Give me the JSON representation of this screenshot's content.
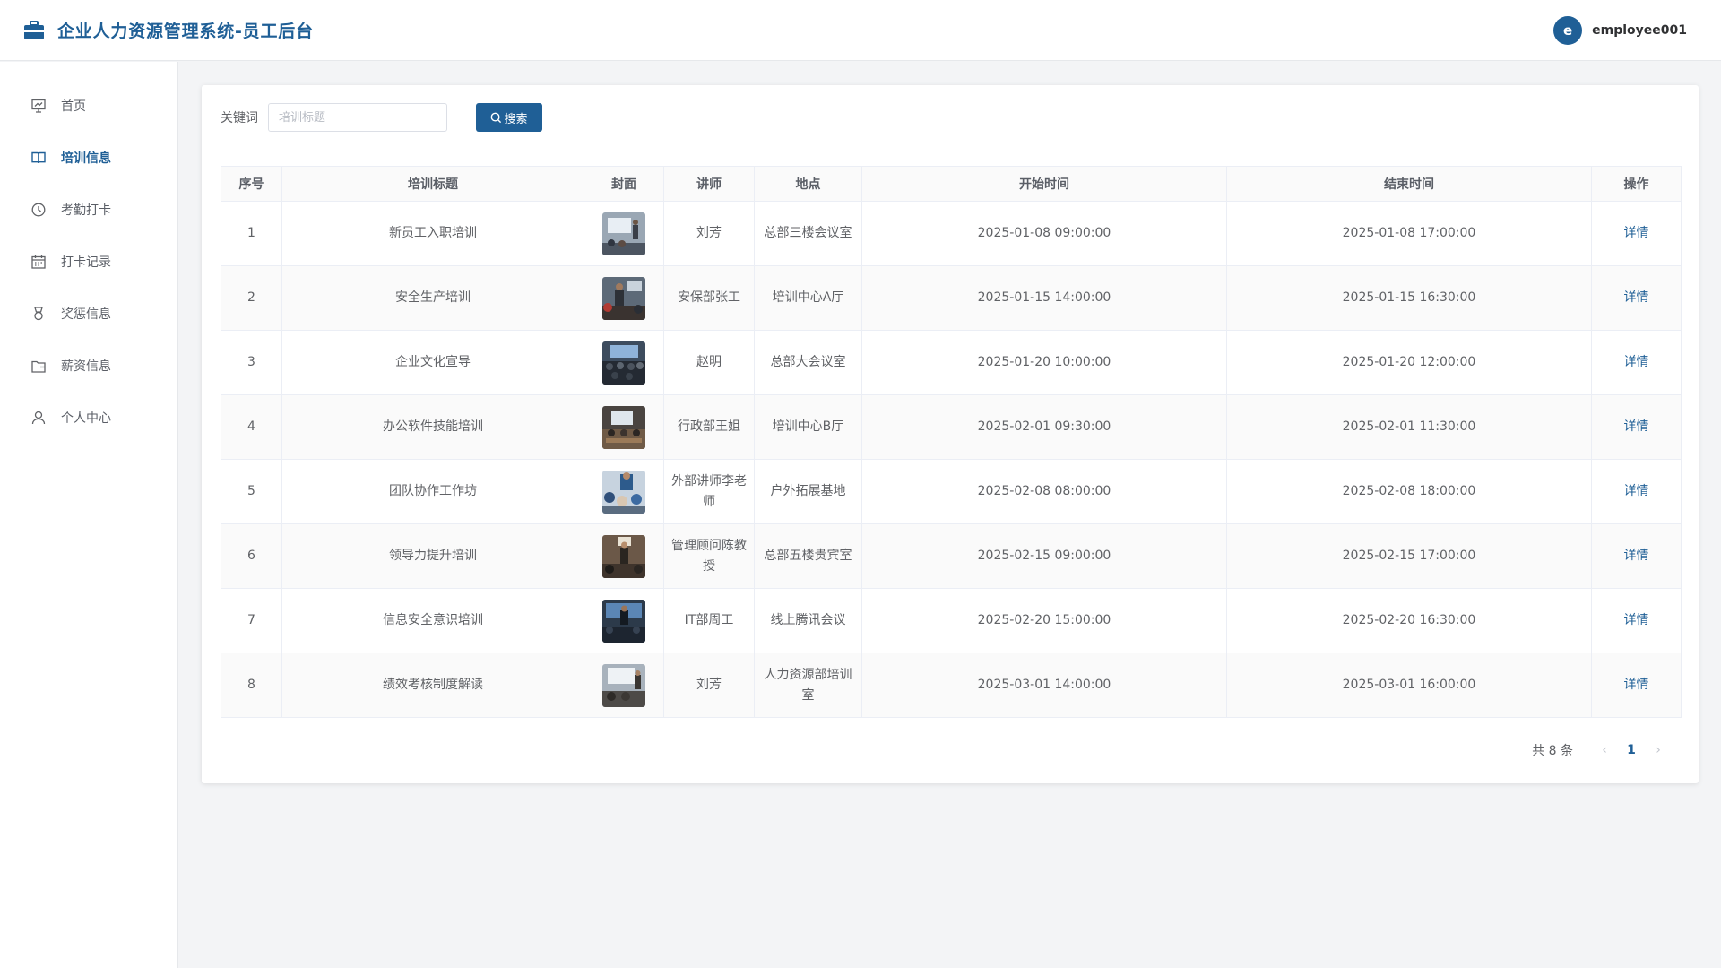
{
  "app": {
    "title": "企业人力资源管理系统-员工后台",
    "brand_color": "#1f5f96"
  },
  "user": {
    "avatar_letter": "e",
    "name": "employee001"
  },
  "sidebar": {
    "items": [
      {
        "label": "首页",
        "icon": "presentation-icon",
        "active": false
      },
      {
        "label": "培训信息",
        "icon": "book-icon",
        "active": true
      },
      {
        "label": "考勤打卡",
        "icon": "clock-icon",
        "active": false
      },
      {
        "label": "打卡记录",
        "icon": "calendar-icon",
        "active": false
      },
      {
        "label": "奖惩信息",
        "icon": "medal-icon",
        "active": false
      },
      {
        "label": "薪资信息",
        "icon": "wallet-icon",
        "active": false
      },
      {
        "label": "个人中心",
        "icon": "user-icon",
        "active": false
      }
    ]
  },
  "search": {
    "label": "关键词",
    "placeholder": "培训标题",
    "value": "",
    "button_label": "搜索"
  },
  "table": {
    "columns": [
      "序号",
      "培训标题",
      "封面",
      "讲师",
      "地点",
      "开始时间",
      "结束时间",
      "操作"
    ],
    "rows": [
      {
        "index": "1",
        "title": "新员工入职培训",
        "lecturer": "刘芳",
        "location": "总部三楼会议室",
        "start": "2025-01-08 09:00:00",
        "end": "2025-01-08 17:00:00",
        "action": "详情"
      },
      {
        "index": "2",
        "title": "安全生产培训",
        "lecturer": "安保部张工",
        "location": "培训中心A厅",
        "start": "2025-01-15 14:00:00",
        "end": "2025-01-15 16:30:00",
        "action": "详情"
      },
      {
        "index": "3",
        "title": "企业文化宣导",
        "lecturer": "赵明",
        "location": "总部大会议室",
        "start": "2025-01-20 10:00:00",
        "end": "2025-01-20 12:00:00",
        "action": "详情"
      },
      {
        "index": "4",
        "title": "办公软件技能培训",
        "lecturer": "行政部王姐",
        "location": "培训中心B厅",
        "start": "2025-02-01 09:30:00",
        "end": "2025-02-01 11:30:00",
        "action": "详情"
      },
      {
        "index": "5",
        "title": "团队协作工作坊",
        "lecturer": "外部讲师李老师",
        "location": "户外拓展基地",
        "start": "2025-02-08 08:00:00",
        "end": "2025-02-08 18:00:00",
        "action": "详情"
      },
      {
        "index": "6",
        "title": "领导力提升培训",
        "lecturer": "管理顾问陈教授",
        "location": "总部五楼贵宾室",
        "start": "2025-02-15 09:00:00",
        "end": "2025-02-15 17:00:00",
        "action": "详情"
      },
      {
        "index": "7",
        "title": "信息安全意识培训",
        "lecturer": "IT部周工",
        "location": "线上腾讯会议",
        "start": "2025-02-20 15:00:00",
        "end": "2025-02-20 16:30:00",
        "action": "详情"
      },
      {
        "index": "8",
        "title": "绩效考核制度解读",
        "lecturer": "刘芳",
        "location": "人力资源部培训室",
        "start": "2025-03-01 14:00:00",
        "end": "2025-03-01 16:00:00",
        "action": "详情"
      }
    ]
  },
  "pagination": {
    "total_text": "共 8 条",
    "current_page": "1",
    "prev": "‹",
    "next": "›"
  }
}
